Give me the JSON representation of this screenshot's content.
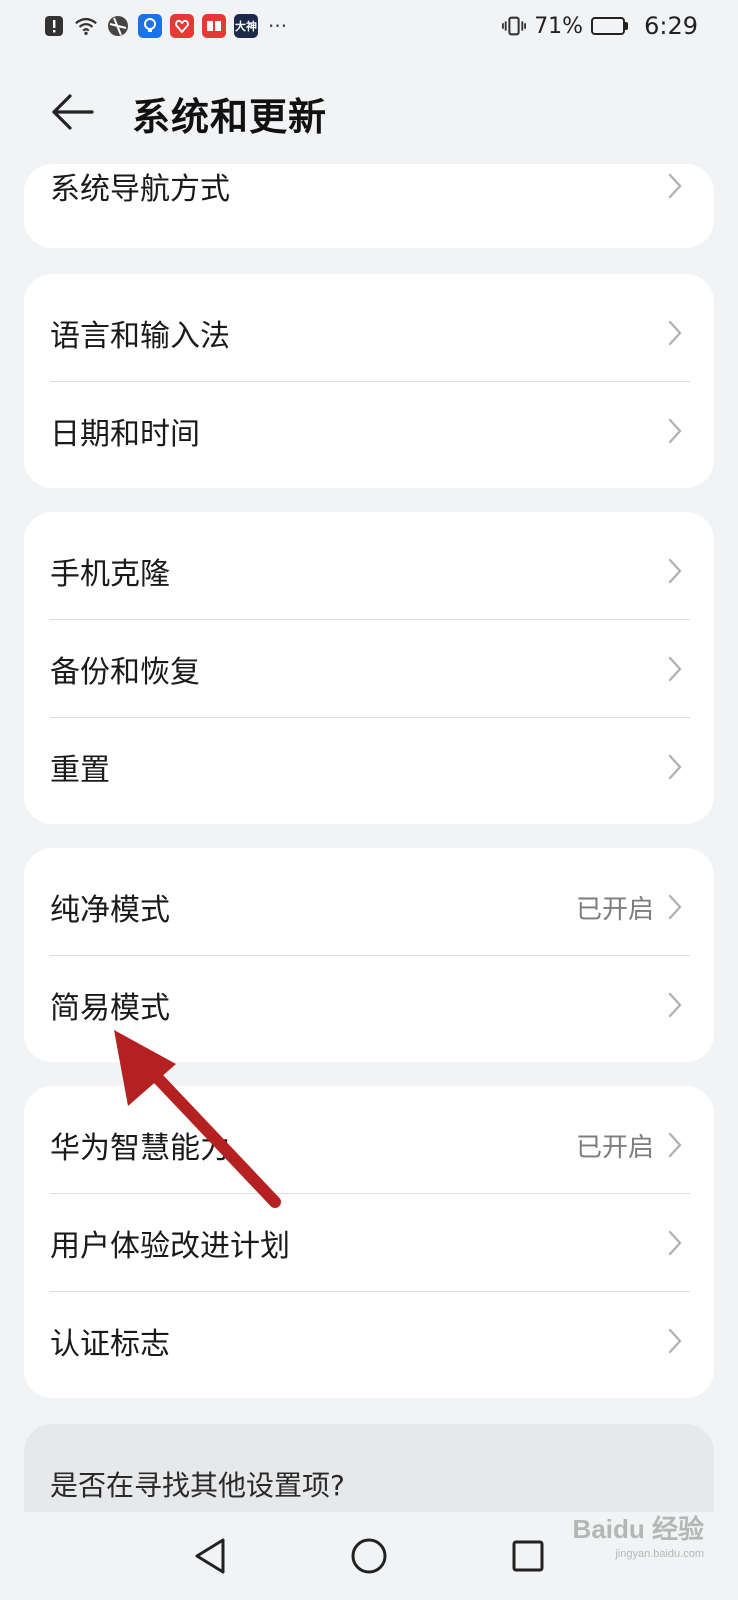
{
  "status_bar": {
    "battery_percent": "71%",
    "time": "6:29",
    "overflow": "···",
    "battery_level": 0.71,
    "app_badges": [
      {
        "name": "bulb-app-icon",
        "color": "#1a73e8"
      },
      {
        "name": "taobao-app-icon",
        "color": "#e53935"
      },
      {
        "name": "reader-app-icon",
        "color": "#e53935"
      },
      {
        "name": "dashen-app-icon",
        "color": "#1b2a4a",
        "text": "大神"
      }
    ]
  },
  "header": {
    "title": "系统和更新"
  },
  "groups": [
    {
      "rows": [
        {
          "label": "系统导航方式",
          "value": ""
        }
      ]
    },
    {
      "rows": [
        {
          "label": "语言和输入法",
          "value": ""
        },
        {
          "label": "日期和时间",
          "value": ""
        }
      ]
    },
    {
      "rows": [
        {
          "label": "手机克隆",
          "value": ""
        },
        {
          "label": "备份和恢复",
          "value": ""
        },
        {
          "label": "重置",
          "value": ""
        }
      ]
    },
    {
      "rows": [
        {
          "label": "纯净模式",
          "value": "已开启"
        },
        {
          "label": "简易模式",
          "value": ""
        }
      ]
    },
    {
      "rows": [
        {
          "label": "华为智慧能力",
          "value": "已开启"
        },
        {
          "label": "用户体验改进计划",
          "value": ""
        },
        {
          "label": "认证标志",
          "value": ""
        }
      ]
    }
  ],
  "search_hint": "是否在寻找其他设置项?",
  "annotation": {
    "arrow_color": "#b52120"
  },
  "watermark": {
    "text": "Baidu 经验",
    "sub": "jingyan.baidu.com"
  }
}
